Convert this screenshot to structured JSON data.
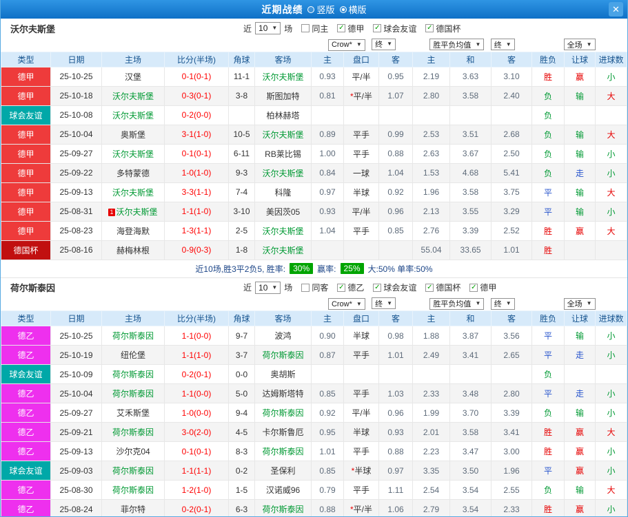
{
  "titlebar": {
    "title": "近期战绩",
    "radio_vertical": "竖版",
    "radio_horizontal": "横版",
    "close": "✕"
  },
  "icons": {
    "caret": "▼",
    "check": "✓"
  },
  "columns": [
    "类型",
    "日期",
    "主场",
    "比分(半场)",
    "角球",
    "客场",
    "主",
    "盘口",
    "客",
    "主",
    "和",
    "客",
    "胜负",
    "让球",
    "进球数"
  ],
  "controls": {
    "near": "近",
    "count": "10",
    "games": "场",
    "odds_company": "Crow*",
    "final1": "终",
    "europe_avg": "胜平负均值",
    "final2": "终",
    "scope": "全场"
  },
  "colors": {
    "league": {
      "德甲": "#ee3b3b",
      "德国杯": "#c11010",
      "球会友谊": "#00a8a8",
      "德乙": "#ee30ee"
    },
    "result": {
      "胜": "#e60000",
      "平": "#2653cc",
      "负": "#009933"
    },
    "cover": {
      "赢": "#e60000",
      "走": "#2653cc",
      "输": "#009933"
    },
    "goals": {
      "大": "#e60000",
      "小": "#009933"
    },
    "team_highlight": "#009933",
    "score": "#ff0000",
    "odds_text": "#5e6b7a",
    "star": "#e60000",
    "chip_bg": "#00a400"
  },
  "sections": [
    {
      "team": "沃尔夫斯堡",
      "checkboxes": [
        {
          "label": "同主",
          "checked": false
        },
        {
          "label": "德甲",
          "checked": true
        },
        {
          "label": "球会友谊",
          "checked": true
        },
        {
          "label": "德国杯",
          "checked": true
        }
      ],
      "rows": [
        {
          "type": "德甲",
          "date": "25-10-25",
          "home": "汉堡",
          "home_hl": false,
          "home_badge": "",
          "score": "0-1(0-1)",
          "corner": "11-1",
          "away": "沃尔夫斯堡",
          "away_hl": true,
          "h": "0.93",
          "hcap": "平/半",
          "a": "0.95",
          "w": "2.19",
          "d": "3.63",
          "l": "3.10",
          "res": "胜",
          "hres": "赢",
          "goal": "小"
        },
        {
          "type": "德甲",
          "date": "25-10-18",
          "home": "沃尔夫斯堡",
          "home_hl": true,
          "home_badge": "",
          "score": "0-3(0-1)",
          "corner": "3-8",
          "away": "斯图加特",
          "away_hl": false,
          "h": "0.81",
          "hcap": "*平/半",
          "a": "1.07",
          "w": "2.80",
          "d": "3.58",
          "l": "2.40",
          "res": "负",
          "hres": "输",
          "goal": "大"
        },
        {
          "type": "球会友谊",
          "date": "25-10-08",
          "home": "沃尔夫斯堡",
          "home_hl": true,
          "home_badge": "",
          "score": "0-2(0-0)",
          "corner": "",
          "away": "柏林赫塔",
          "away_hl": false,
          "h": "",
          "hcap": "",
          "a": "",
          "w": "",
          "d": "",
          "l": "",
          "res": "负",
          "hres": "",
          "goal": ""
        },
        {
          "type": "德甲",
          "date": "25-10-04",
          "home": "奥斯堡",
          "home_hl": false,
          "home_badge": "",
          "score": "3-1(1-0)",
          "corner": "10-5",
          "away": "沃尔夫斯堡",
          "away_hl": true,
          "h": "0.89",
          "hcap": "平手",
          "a": "0.99",
          "w": "2.53",
          "d": "3.51",
          "l": "2.68",
          "res": "负",
          "hres": "输",
          "goal": "大"
        },
        {
          "type": "德甲",
          "date": "25-09-27",
          "home": "沃尔夫斯堡",
          "home_hl": true,
          "home_badge": "",
          "score": "0-1(0-1)",
          "corner": "6-11",
          "away": "RB莱比锡",
          "away_hl": false,
          "h": "1.00",
          "hcap": "平手",
          "a": "0.88",
          "w": "2.63",
          "d": "3.67",
          "l": "2.50",
          "res": "负",
          "hres": "输",
          "goal": "小"
        },
        {
          "type": "德甲",
          "date": "25-09-22",
          "home": "多特蒙德",
          "home_hl": false,
          "home_badge": "",
          "score": "1-0(1-0)",
          "corner": "9-3",
          "away": "沃尔夫斯堡",
          "away_hl": true,
          "h": "0.84",
          "hcap": "一球",
          "a": "1.04",
          "w": "1.53",
          "d": "4.68",
          "l": "5.41",
          "res": "负",
          "hres": "走",
          "goal": "小"
        },
        {
          "type": "德甲",
          "date": "25-09-13",
          "home": "沃尔夫斯堡",
          "home_hl": true,
          "home_badge": "",
          "score": "3-3(1-1)",
          "corner": "7-4",
          "away": "科隆",
          "away_hl": false,
          "h": "0.97",
          "hcap": "半球",
          "a": "0.92",
          "w": "1.96",
          "d": "3.58",
          "l": "3.75",
          "res": "平",
          "hres": "输",
          "goal": "大"
        },
        {
          "type": "德甲",
          "date": "25-08-31",
          "home": "沃尔夫斯堡",
          "home_hl": true,
          "home_badge": "1",
          "score": "1-1(1-0)",
          "corner": "3-10",
          "away": "美因茨05",
          "away_hl": false,
          "h": "0.93",
          "hcap": "平/半",
          "a": "0.96",
          "w": "2.13",
          "d": "3.55",
          "l": "3.29",
          "res": "平",
          "hres": "输",
          "goal": "小"
        },
        {
          "type": "德甲",
          "date": "25-08-23",
          "home": "海登海默",
          "home_hl": false,
          "home_badge": "",
          "score": "1-3(1-1)",
          "corner": "2-5",
          "away": "沃尔夫斯堡",
          "away_hl": true,
          "h": "1.04",
          "hcap": "平手",
          "a": "0.85",
          "w": "2.76",
          "d": "3.39",
          "l": "2.52",
          "res": "胜",
          "hres": "赢",
          "goal": "大"
        },
        {
          "type": "德国杯",
          "date": "25-08-16",
          "home": "赫梅林根",
          "home_hl": false,
          "home_badge": "",
          "score": "0-9(0-3)",
          "corner": "1-8",
          "away": "沃尔夫斯堡",
          "away_hl": true,
          "h": "",
          "hcap": "",
          "a": "",
          "w": "55.04",
          "d": "33.65",
          "l": "1.01",
          "res": "胜",
          "hres": "",
          "goal": ""
        }
      ],
      "summary": {
        "lead": "近10场,胜3平2负5, 胜率:",
        "win_rate": "30%",
        "cover_label": "赢率:",
        "cover_rate": "25%",
        "tail": "大:50% 单率:50%"
      }
    },
    {
      "team": "荷尔斯泰因",
      "checkboxes": [
        {
          "label": "同客",
          "checked": false
        },
        {
          "label": "德乙",
          "checked": true
        },
        {
          "label": "球会友谊",
          "checked": true
        },
        {
          "label": "德国杯",
          "checked": true
        },
        {
          "label": "德甲",
          "checked": true
        }
      ],
      "rows": [
        {
          "type": "德乙",
          "date": "25-10-25",
          "home": "荷尔斯泰因",
          "home_hl": true,
          "home_badge": "",
          "score": "1-1(0-0)",
          "corner": "9-7",
          "away": "波鸿",
          "away_hl": false,
          "h": "0.90",
          "hcap": "半球",
          "a": "0.98",
          "w": "1.88",
          "d": "3.87",
          "l": "3.56",
          "res": "平",
          "hres": "输",
          "goal": "小"
        },
        {
          "type": "德乙",
          "date": "25-10-19",
          "home": "纽伦堡",
          "home_hl": false,
          "home_badge": "",
          "score": "1-1(1-0)",
          "corner": "3-7",
          "away": "荷尔斯泰因",
          "away_hl": true,
          "h": "0.87",
          "hcap": "平手",
          "a": "1.01",
          "w": "2.49",
          "d": "3.41",
          "l": "2.65",
          "res": "平",
          "hres": "走",
          "goal": "小"
        },
        {
          "type": "球会友谊",
          "date": "25-10-09",
          "home": "荷尔斯泰因",
          "home_hl": true,
          "home_badge": "",
          "score": "0-2(0-1)",
          "corner": "0-0",
          "away": "奥胡斯",
          "away_hl": false,
          "h": "",
          "hcap": "",
          "a": "",
          "w": "",
          "d": "",
          "l": "",
          "res": "负",
          "hres": "",
          "goal": ""
        },
        {
          "type": "德乙",
          "date": "25-10-04",
          "home": "荷尔斯泰因",
          "home_hl": true,
          "home_badge": "",
          "score": "1-1(0-0)",
          "corner": "5-0",
          "away": "达姆斯塔特",
          "away_hl": false,
          "h": "0.85",
          "hcap": "平手",
          "a": "1.03",
          "w": "2.33",
          "d": "3.48",
          "l": "2.80",
          "res": "平",
          "hres": "走",
          "goal": "小"
        },
        {
          "type": "德乙",
          "date": "25-09-27",
          "home": "艾禾斯堡",
          "home_hl": false,
          "home_badge": "",
          "score": "1-0(0-0)",
          "corner": "9-4",
          "away": "荷尔斯泰因",
          "away_hl": true,
          "h": "0.92",
          "hcap": "平/半",
          "a": "0.96",
          "w": "1.99",
          "d": "3.70",
          "l": "3.39",
          "res": "负",
          "hres": "输",
          "goal": "小"
        },
        {
          "type": "德乙",
          "date": "25-09-21",
          "home": "荷尔斯泰因",
          "home_hl": true,
          "home_badge": "",
          "score": "3-0(2-0)",
          "corner": "4-5",
          "away": "卡尔斯鲁厄",
          "away_hl": false,
          "h": "0.95",
          "hcap": "半球",
          "a": "0.93",
          "w": "2.01",
          "d": "3.58",
          "l": "3.41",
          "res": "胜",
          "hres": "赢",
          "goal": "大"
        },
        {
          "type": "德乙",
          "date": "25-09-13",
          "home": "沙尔克04",
          "home_hl": false,
          "home_badge": "",
          "score": "0-1(0-1)",
          "corner": "8-3",
          "away": "荷尔斯泰因",
          "away_hl": true,
          "h": "1.01",
          "hcap": "平手",
          "a": "0.88",
          "w": "2.23",
          "d": "3.47",
          "l": "3.00",
          "res": "胜",
          "hres": "赢",
          "goal": "小"
        },
        {
          "type": "球会友谊",
          "date": "25-09-03",
          "home": "荷尔斯泰因",
          "home_hl": true,
          "home_badge": "",
          "score": "1-1(1-1)",
          "corner": "0-2",
          "away": "圣保利",
          "away_hl": false,
          "h": "0.85",
          "hcap": "*半球",
          "a": "0.97",
          "w": "3.35",
          "d": "3.50",
          "l": "1.96",
          "res": "平",
          "hres": "赢",
          "goal": "小"
        },
        {
          "type": "德乙",
          "date": "25-08-30",
          "home": "荷尔斯泰因",
          "home_hl": true,
          "home_badge": "",
          "score": "1-2(1-0)",
          "corner": "1-5",
          "away": "汉诺威96",
          "away_hl": false,
          "h": "0.79",
          "hcap": "平手",
          "a": "1.11",
          "w": "2.54",
          "d": "3.54",
          "l": "2.55",
          "res": "负",
          "hres": "输",
          "goal": "大"
        },
        {
          "type": "德乙",
          "date": "25-08-24",
          "home": "菲尔特",
          "home_hl": false,
          "home_badge": "",
          "score": "0-2(0-1)",
          "corner": "6-3",
          "away": "荷尔斯泰因",
          "away_hl": true,
          "h": "0.88",
          "hcap": "*平/半",
          "a": "1.06",
          "w": "2.79",
          "d": "3.54",
          "l": "2.33",
          "res": "胜",
          "hres": "赢",
          "goal": "小"
        }
      ]
    }
  ]
}
